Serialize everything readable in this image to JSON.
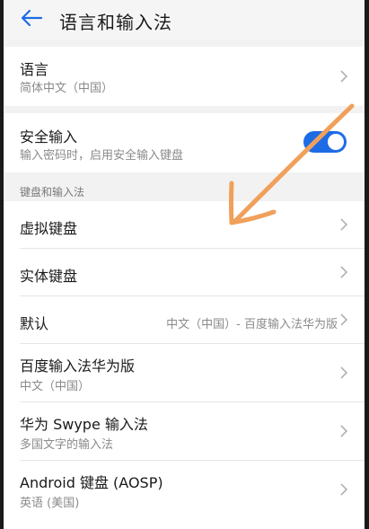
{
  "appbar": {
    "title": "语言和输入法",
    "back_icon": "arrow-left-icon"
  },
  "language": {
    "title": "语言",
    "value": "简体中文（中国）"
  },
  "secure_input": {
    "title": "安全输入",
    "subtitle": "输入密码时，启用安全输入键盘",
    "enabled": true
  },
  "section_keyboard": {
    "header": "键盘和输入法"
  },
  "items": [
    {
      "title": "虚拟键盘"
    },
    {
      "title": "实体键盘"
    },
    {
      "title": "默认",
      "value": "中文（中国）- 百度输入法华为版"
    },
    {
      "title": "百度输入法华为版",
      "subtitle": "中文（中国）"
    },
    {
      "title": "华为 Swype 输入法",
      "subtitle": "多国文字的输入法"
    },
    {
      "title": "Android 键盘 (AOSP)",
      "subtitle": "英语 (美国)"
    }
  ],
  "colors": {
    "accent": "#1e6be6",
    "annotation_arrow": "#f0a05a",
    "background": "#f2f2f2"
  }
}
